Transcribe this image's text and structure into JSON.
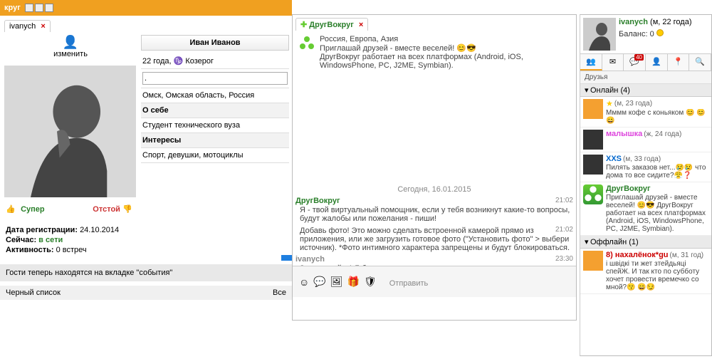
{
  "app": {
    "title_partial": "круг",
    "tab_left": "ivanych"
  },
  "edit": {
    "label": "изменить"
  },
  "profile": {
    "name": "Иван Иванов",
    "age_sign": "22 года,  ♑ Козерог",
    "status_value": ".",
    "location": "Омск, Омская область, Россия",
    "about_hdr": "О себе",
    "about_val": "Студент технического вуза",
    "interests_hdr": "Интересы",
    "interests_val": "Спорт, девушки, мотоциклы"
  },
  "rating": {
    "good": "Супер",
    "bad": "Отстой"
  },
  "meta": {
    "reg_label": "Дата регистрации:",
    "reg_val": "24.10.2014",
    "now_label": "Сейчас:",
    "now_val": "в сети",
    "act_label": "Активность:",
    "act_val": "0 встреч"
  },
  "notice": "Гости теперь находятся на вкладке \"события\"",
  "blacklist": {
    "label": "Черный список",
    "val": "Все"
  },
  "chat": {
    "tab": "ДругВокруг",
    "sys_line1": "Россия, Европа, Азия",
    "sys_line2": "Приглашай друзей - вместе веселей! 😊😎",
    "sys_line3": "ДругВокруг работает на всех платформах (Android, iOS, WindowsPhone, PC, J2ME, Symbian).",
    "date": "Сегодня, 16.01.2015",
    "msgs": [
      {
        "from": "ДругВокруг",
        "cls": "dv",
        "time": "21:02",
        "body": "Я - твой виртуальный помощник, если у тебя возникнут какие-то вопросы, будут жалобы или пожелания - пиши!"
      },
      {
        "from": "",
        "cls": "dv",
        "time": "21:02",
        "body": "Добавь фото! Это можно сделать встроенной камерой прямо из приложения, или же загрузить готовое фото (\"Установить фото\" > выбери источник). *Фото интимного характера запрещены и будут блокироваться."
      },
      {
        "from": "ivanych",
        "cls": "iv",
        "time": "23:30",
        "body": "Здравствуйте! Я бы хотел удалить свою страницу, потому что не вижу смысла в своем дальнейшем прибывании в вашей замечательной соцсети. Заранее благодарен за ответ."
      }
    ],
    "send": "Отправить"
  },
  "me": {
    "nick": "ivanych",
    "meta": "(м, 22 года)",
    "balance_label": "Баланс:",
    "balance_val": "0"
  },
  "toolbar": {
    "badge": "40"
  },
  "friends_hdr": "Друзья",
  "sections": {
    "online": "Онлайн (4)",
    "offline": "Оффлайн (1)"
  },
  "friends": [
    {
      "nick": "",
      "nick_cls": "",
      "meta": "(м, 23 года)",
      "status": "Мммм кофе с коньяком 😊 😊 😄",
      "av": "orange",
      "star": true
    },
    {
      "nick": "малышка",
      "nick_cls": "pink",
      "meta": "(ж, 24 года)",
      "status": "",
      "av": "dark"
    },
    {
      "nick": "XXS",
      "nick_cls": "blue",
      "meta": "(м, 33 года)",
      "status": "Пилять заказов нет...😢😢 что дома то все сидите?😤❓",
      "av": "dark"
    },
    {
      "nick": "ДругВокруг",
      "nick_cls": "greent",
      "meta": "",
      "status": "Приглашай друзей - вместе веселей! 😊😎 ДругВокруг работает на всех платформах (Android, iOS, WindowsPhone, PC, J2ME, Symbian).",
      "av": "green"
    }
  ],
  "offline_friend": {
    "nick": "8) нахалёнок*gu",
    "nick_cls": "red",
    "meta": "(м, 31 год)",
    "status": "і швідкі ти жет зтейдьяці спейЖ. И так кто по субботу хочет провести времечко со мной?😙 😄😏",
    "av": "orange"
  }
}
